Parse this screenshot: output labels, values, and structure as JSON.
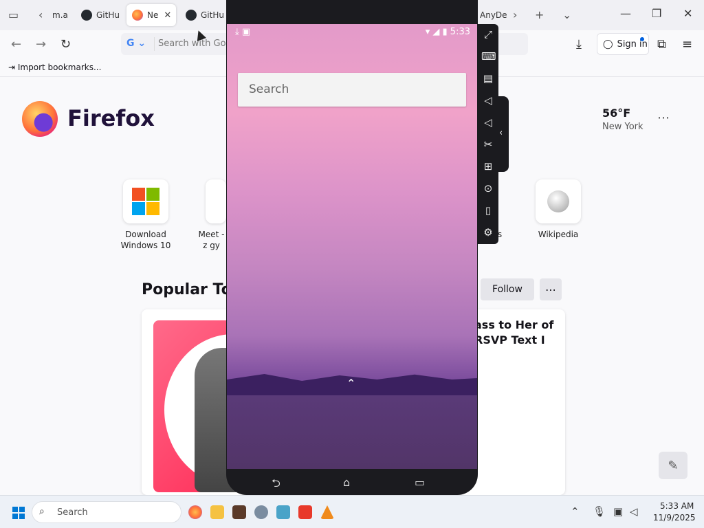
{
  "browser": {
    "tabs": [
      {
        "label": "m.a"
      },
      {
        "label": "GitHu"
      },
      {
        "label": "Ne"
      },
      {
        "label": "GitHu"
      },
      {
        "label": "AnyDe"
      }
    ],
    "url_placeholder": "Search with Goo",
    "sign_in_label": "Sign in",
    "bookmarks_label": "Import bookmarks..."
  },
  "newtab": {
    "logo_text": "Firefox",
    "weather": {
      "temp": "56°F",
      "location": "New York"
    },
    "shortcuts": [
      {
        "label": "Download Windows 10"
      },
      {
        "label": "Meet - z gy"
      },
      {
        "label": "al ps"
      },
      {
        "label": "Wikipedia"
      }
    ],
    "popular_title": "Popular Top",
    "follow_label": "Follow",
    "card_title": "ass to Her of RSVP Text I"
  },
  "emulator": {
    "status_time": "5:33",
    "search_placeholder": "Search"
  },
  "taskbar": {
    "search_label": "Search",
    "time": "5:33 AM",
    "date": "11/9/2025"
  },
  "colors": {
    "accent": "#0060df",
    "wallpaper_top": "#e39ac9",
    "wallpaper_bottom": "#4f2f72"
  }
}
